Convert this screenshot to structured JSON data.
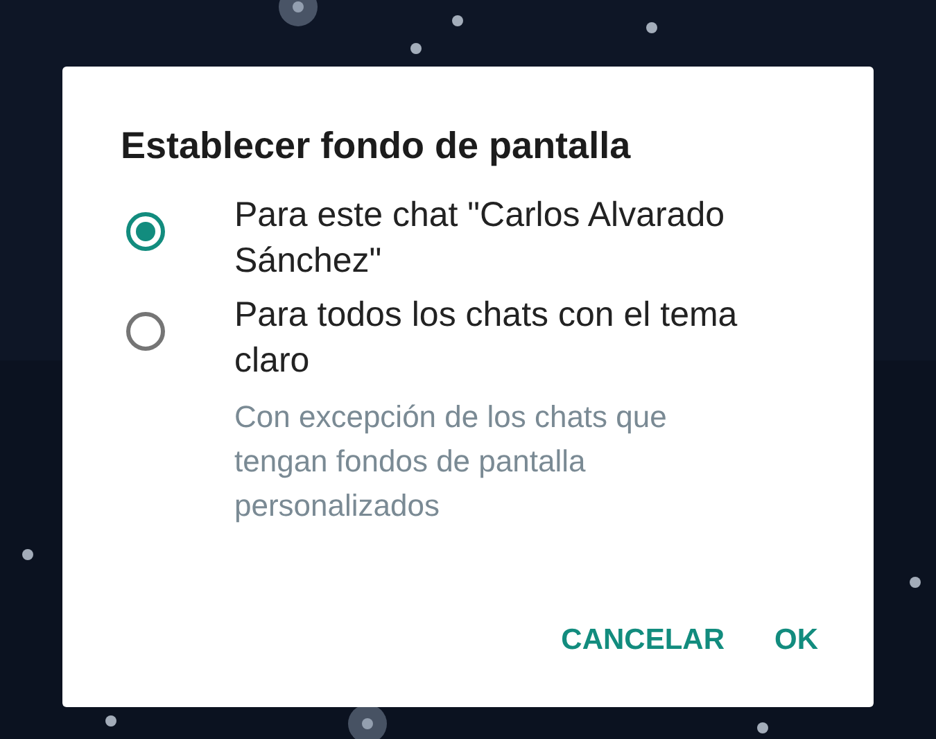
{
  "dialog": {
    "title": "Establecer fondo de pantalla",
    "options": [
      {
        "label": "Para este chat \"Carlos Alvarado Sánchez\"",
        "selected": true
      },
      {
        "label": "Para todos los chats con el tema claro",
        "description": "Con excepción de los chats que tengan fondos de pantalla personalizados",
        "selected": false
      }
    ],
    "buttons": [
      "CANCELAR",
      "OK"
    ]
  }
}
